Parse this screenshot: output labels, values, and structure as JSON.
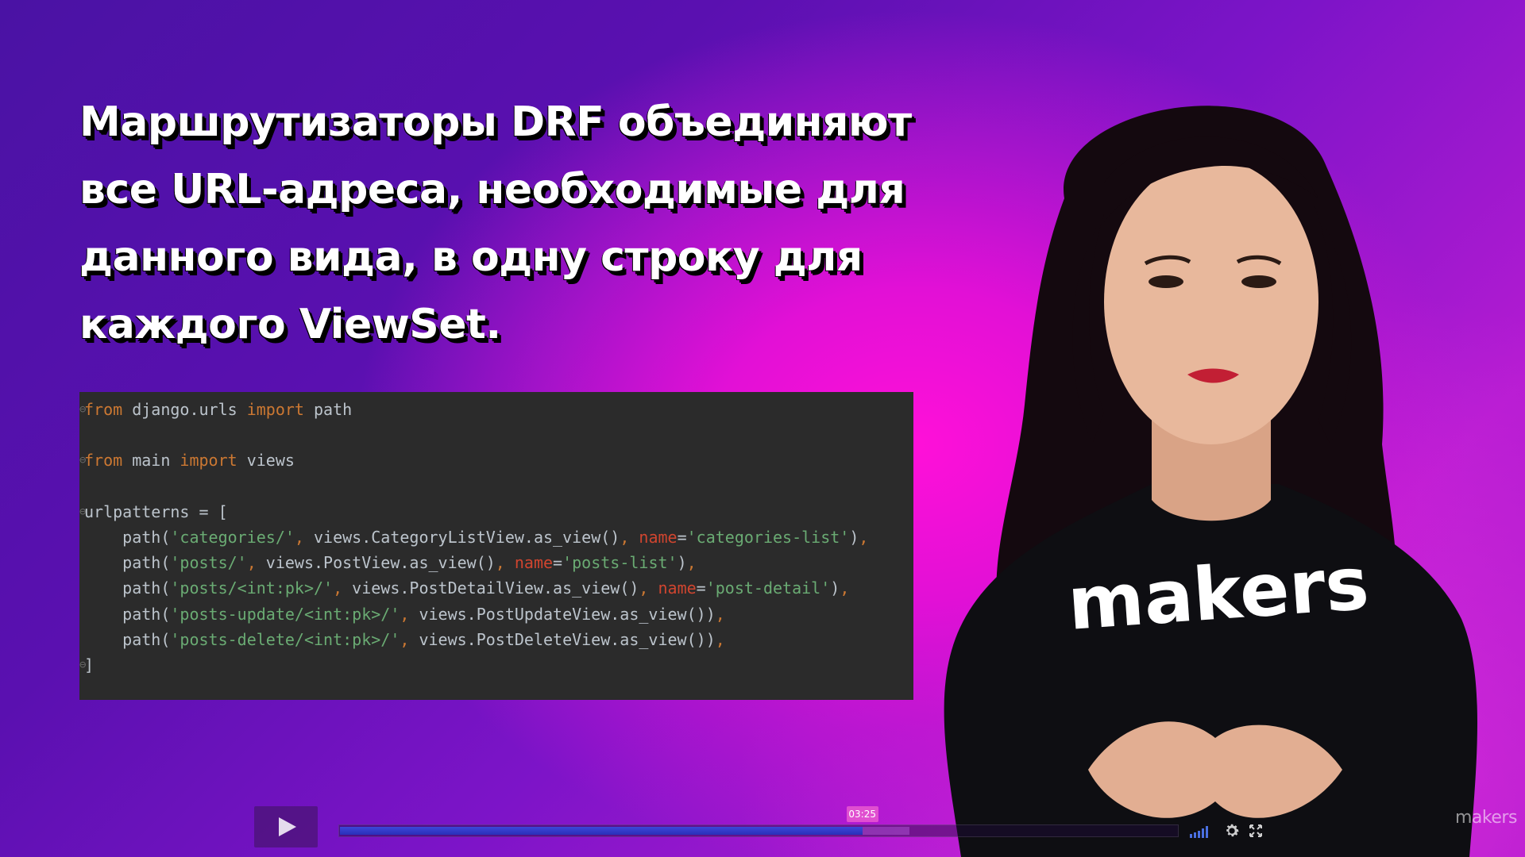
{
  "slide": {
    "headline_lines": [
      "Маршрутизаторы DRF объединяют",
      "все URL-адреса, необходимые для",
      "данного вида, в одну строку для",
      "каждого ViewSet."
    ],
    "code": {
      "line1": {
        "kw1": "from",
        "mod": " django.urls ",
        "kw2": "import",
        "name": " path"
      },
      "line3": {
        "kw1": "from",
        "mod": " main ",
        "kw2": "import",
        "name": " views"
      },
      "line5": {
        "text": "urlpatterns = ["
      },
      "routes": [
        {
          "route": "'categories/'",
          "view": " views.CategoryListView.as_view()",
          "name_kw": "name",
          "name_val": "'categories-list'"
        },
        {
          "route": "'posts/'",
          "view": " views.PostView.as_view()",
          "name_kw": "name",
          "name_val": "'posts-list'"
        },
        {
          "route": "'posts/<int:pk>/'",
          "view": " views.PostDetailView.as_view()",
          "name_kw": "name",
          "name_val": "'post-detail'"
        },
        {
          "route": "'posts-update/<int:pk>/'",
          "view": " views.PostUpdateView.as_view()",
          "name_kw": "",
          "name_val": ""
        },
        {
          "route": "'posts-delete/<int:pk>/'",
          "view": " views.PostDeleteView.as_view()",
          "name_kw": "",
          "name_val": ""
        }
      ],
      "closing": "]"
    },
    "shirt_logo": "makers"
  },
  "player": {
    "current_time": "03:25",
    "progress_fraction": 0.624,
    "buffered_fraction": 0.68,
    "watermark": "makers",
    "icons": [
      "play-icon",
      "volume-icon",
      "gear-icon",
      "fullscreen-icon"
    ]
  },
  "colors": {
    "keyword": "#cc7832",
    "string": "#6aab73",
    "named_arg": "#d0452f",
    "code_bg": "#2b2b2b",
    "progress": "#3d46d8",
    "time_badge": "#e04fd0"
  }
}
